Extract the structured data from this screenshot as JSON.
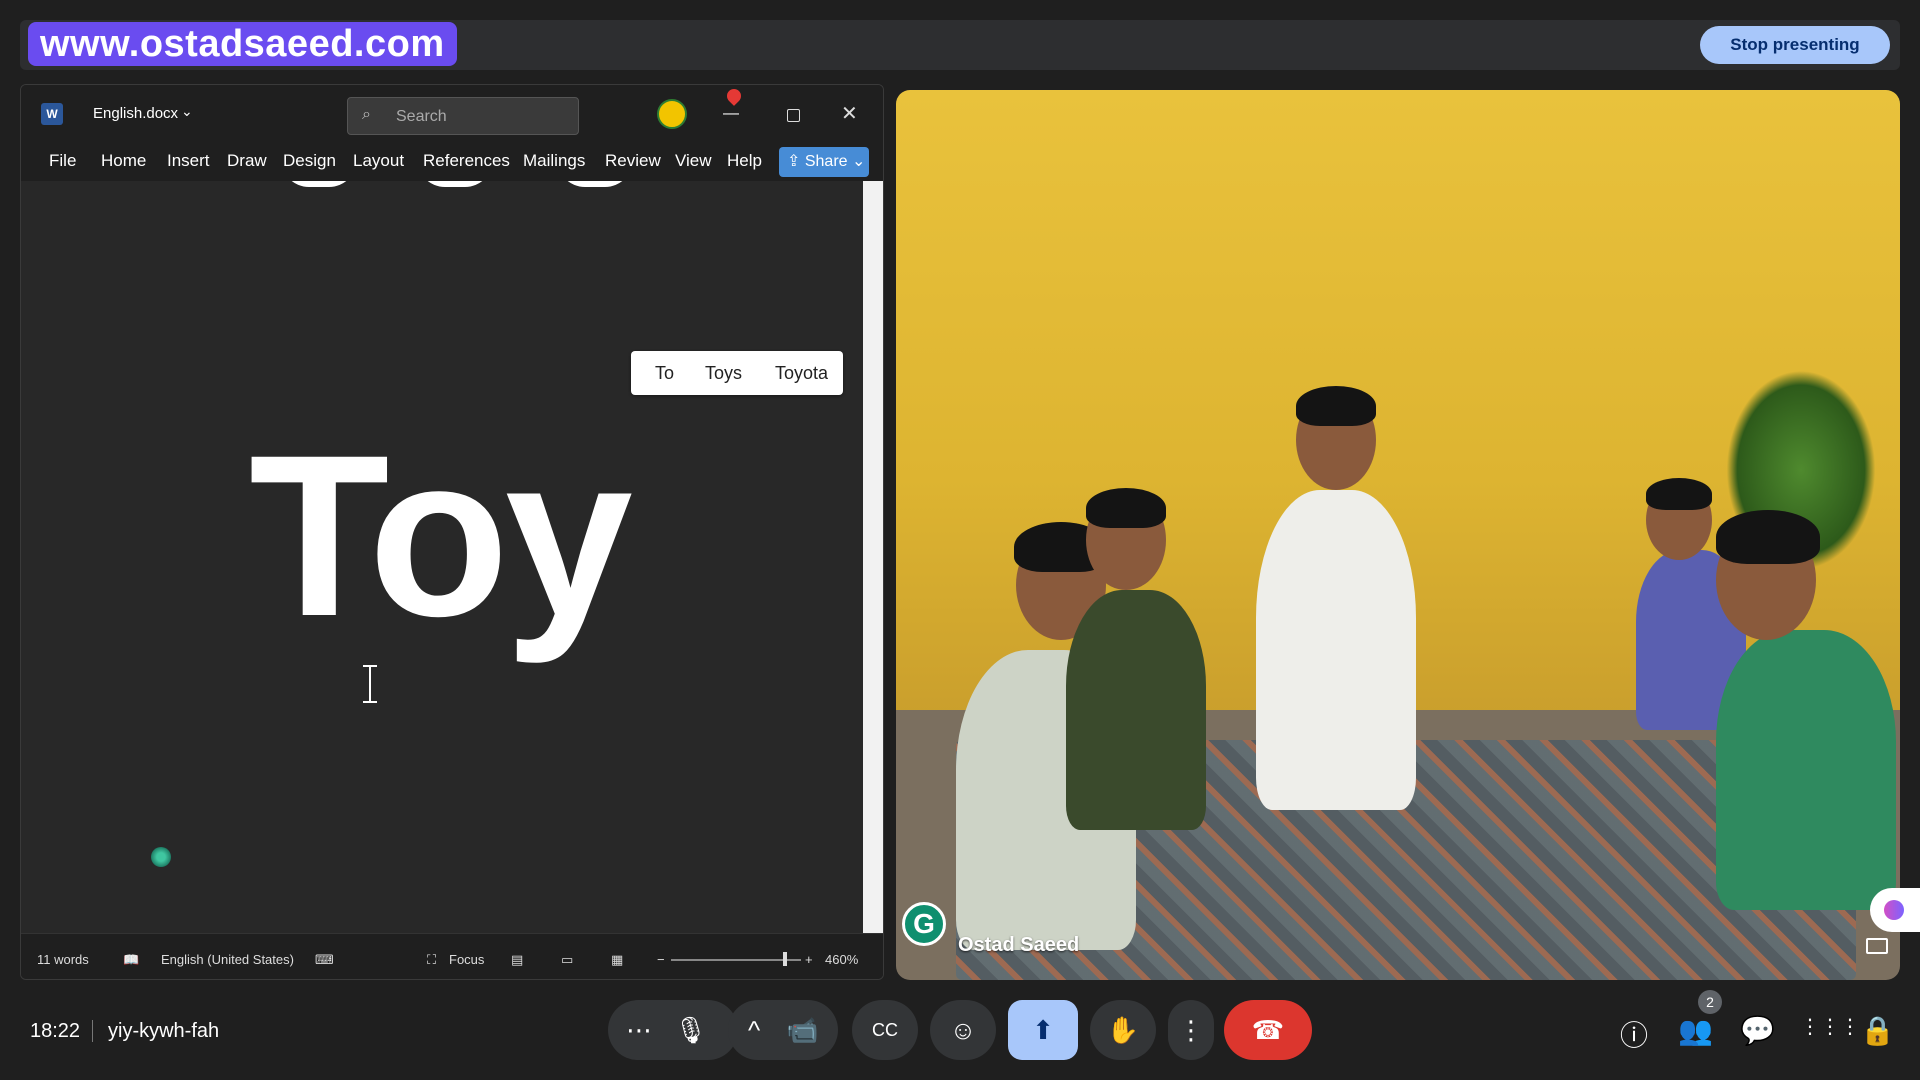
{
  "watermark": "www.ostadsaeed.com",
  "stop_presenting": "Stop presenting",
  "word": {
    "logo": "W",
    "doc_name": "English.docx",
    "search_placeholder": "Search",
    "ribbon": [
      "File",
      "Home",
      "Insert",
      "Draw",
      "Design",
      "Layout",
      "References",
      "Mailings",
      "Review",
      "View",
      "Help"
    ],
    "share": "Share",
    "autocomplete": [
      "To",
      "Toys",
      "Toyota"
    ],
    "big_text": "Toy",
    "status": {
      "words": "11 words",
      "language": "English (United States)",
      "focus": "Focus",
      "zoom": "460%",
      "zoom_minus": "−",
      "zoom_plus": "+"
    }
  },
  "video": {
    "participant": "Ostad Saeed",
    "badge_letter": "G"
  },
  "bottom_bar": {
    "time": "18:22",
    "meeting_code": "yiy-kywh-fah",
    "people_count": "2",
    "controls": {
      "more": "⋯",
      "mic": "🎙",
      "caret": "^",
      "camera": "📹",
      "captions": "CC",
      "emoji": "☺",
      "present": "⬆",
      "hand": "✋",
      "options": "⋮",
      "end_call": "☎"
    },
    "right_icons": {
      "info": "ⓘ",
      "people": "👥",
      "chat": "💬",
      "apps": "⋮⋮⋮",
      "lock": "🔒"
    }
  },
  "colors": {
    "accent": "#a8c7fa",
    "end_call": "#dc362e",
    "watermark_bg": "#6a4cf0",
    "word_blue": "#2b579a"
  }
}
